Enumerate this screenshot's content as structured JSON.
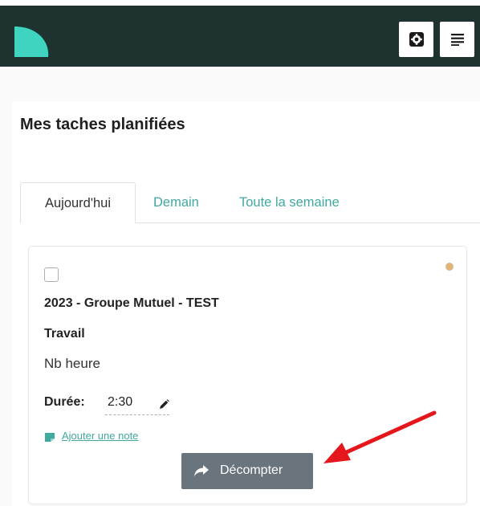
{
  "header": {
    "logo_icon": "teal-leaf-logo",
    "settings_icon": "settings-icon",
    "menu_icon": "menu-lines-icon",
    "background": "#1e332f",
    "logo_color": "#3fd4bf"
  },
  "page": {
    "title": "Mes taches planifiées"
  },
  "tabs": [
    {
      "label": "Aujourd'hui",
      "active": true
    },
    {
      "label": "Demain",
      "active": false
    },
    {
      "label": "Toute la semaine",
      "active": false
    }
  ],
  "task": {
    "project": "2023 - Groupe Mutuel - TEST",
    "category": "Travail",
    "type": "Nb heure",
    "duration_label": "Durée:",
    "duration_value": "2:30",
    "add_note_label": "Ajouter une note",
    "count_button_label": "Décompter",
    "status_color": "#e2b37f",
    "accent_color": "#41a9a0"
  },
  "annotation": {
    "arrow_color": "#e5161c"
  }
}
